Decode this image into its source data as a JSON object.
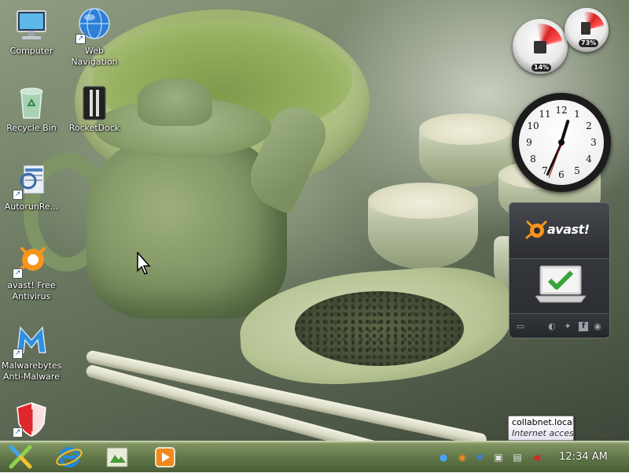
{
  "desktop": {
    "icons": [
      {
        "label": "Computer"
      },
      {
        "label": "Web Navigation"
      },
      {
        "label": "Recycle Bin"
      },
      {
        "label": "RocketDock"
      },
      {
        "label": "AutorunRe..."
      },
      {
        "label": "avast! Free Antivirus"
      },
      {
        "label": "Malwarebytes Anti-Malware"
      }
    ]
  },
  "gadgets": {
    "cpu_meter": {
      "cpu": "14%",
      "memory": "73%"
    },
    "clock": {
      "numbers": [
        "12",
        "1",
        "2",
        "3",
        "4",
        "5",
        "6",
        "7",
        "8",
        "9",
        "10",
        "11"
      ]
    },
    "avast": {
      "logo_text": "avast!",
      "icons": [
        "window-icon",
        "refresh-icon",
        "twitter-icon",
        "facebook-icon",
        "rss-icon"
      ]
    }
  },
  "tooltip": {
    "title": "collabnet.local",
    "subtitle": "Internet access"
  },
  "taskbar": {
    "pinned": [
      "start-x-icon",
      "internet-explorer-icon",
      "file-manager-icon",
      "media-player-icon"
    ],
    "tray": [
      "chrome-icon",
      "firefox-icon",
      "bluetooth-icon",
      "network-icon",
      "notification-icon",
      "volume-muted-icon"
    ],
    "time": "12:34 AM"
  },
  "colors": {
    "taskbar": "#5f7547",
    "avast_orange": "#f7941d",
    "check_green": "#37a63b"
  }
}
